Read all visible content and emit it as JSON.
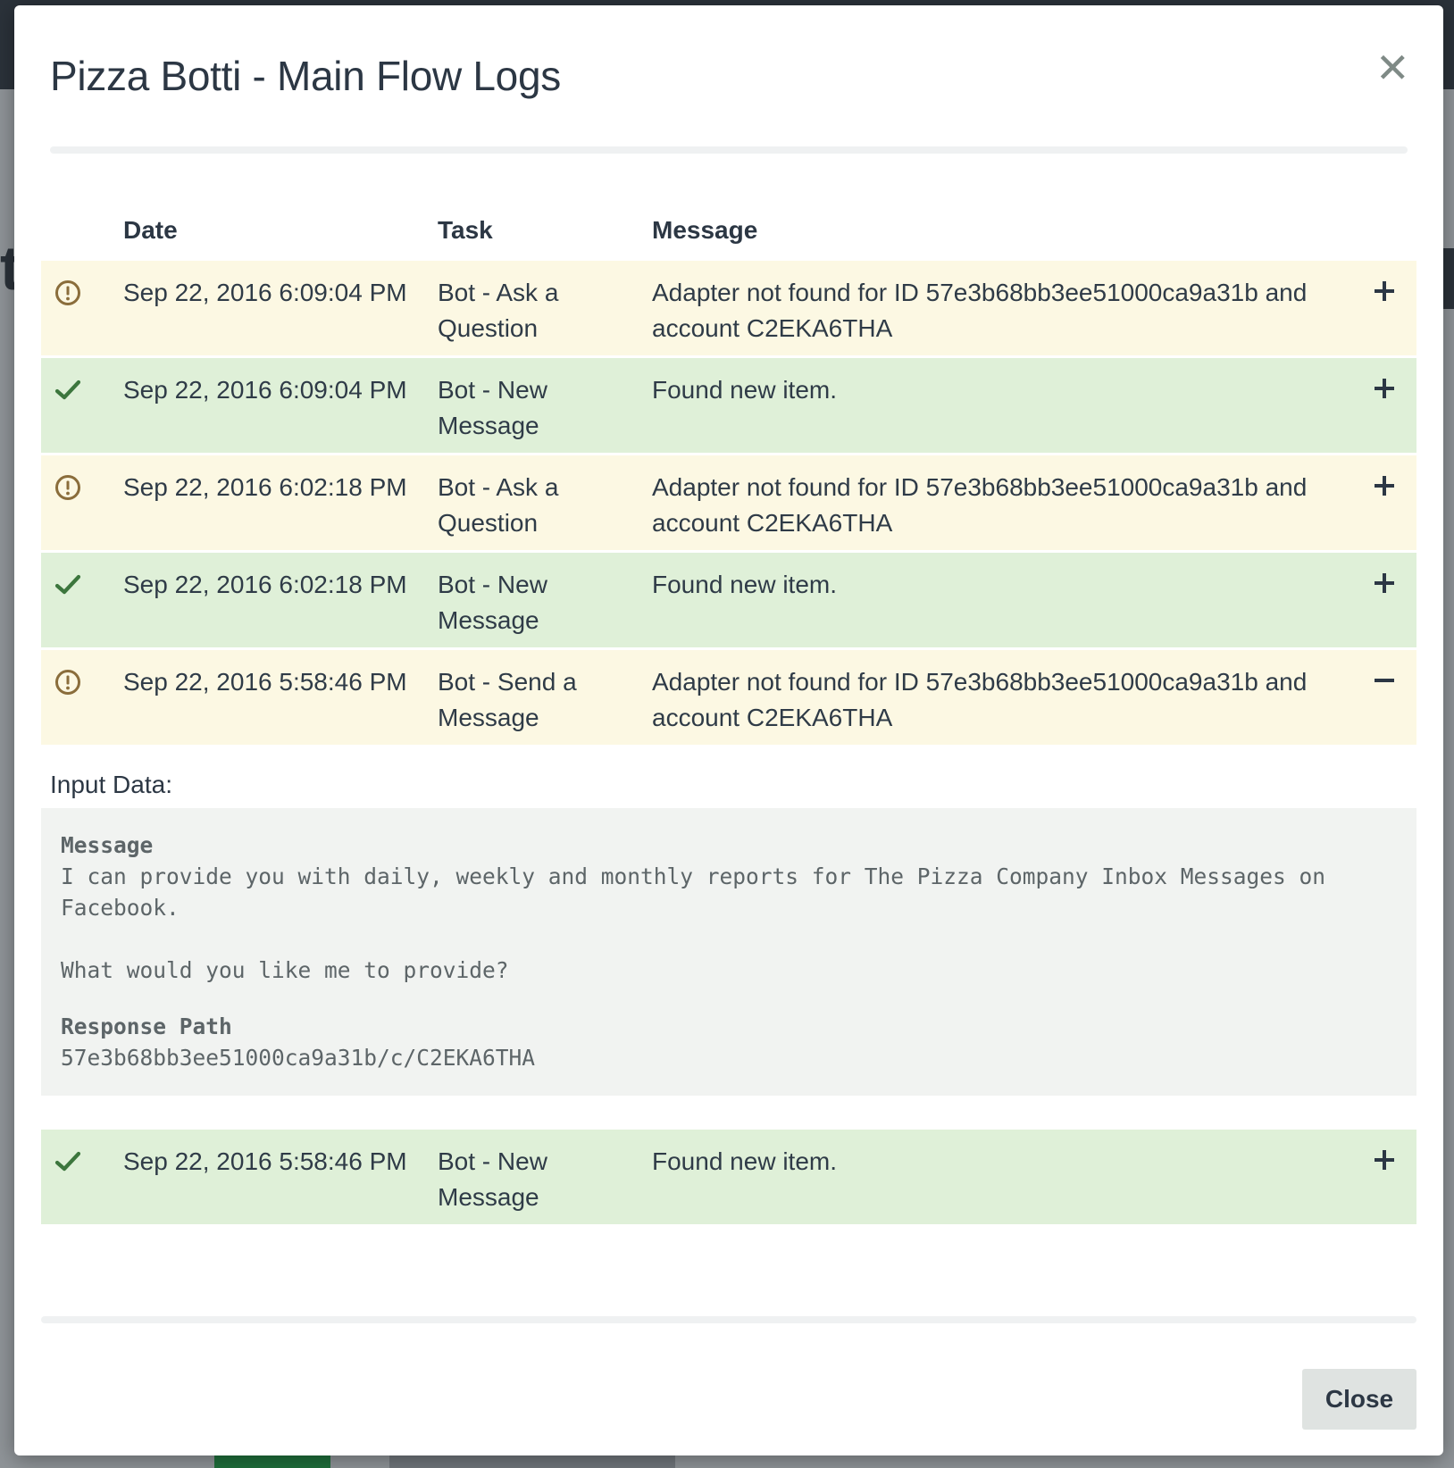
{
  "modal": {
    "title": "Pizza Botti - Main Flow Logs",
    "close_button_label": "Close"
  },
  "table": {
    "headers": {
      "date": "Date",
      "task": "Task",
      "message": "Message"
    },
    "rows": [
      {
        "status": "warning",
        "status_icon": "exclamation-circle-icon",
        "date": "Sep 22, 2016 6:09:04 PM",
        "task": "Bot - Ask a Question",
        "message": "Adapter not found for ID 57e3b68bb3ee51000ca9a31b and account C2EKA6THA",
        "expanded": false
      },
      {
        "status": "success",
        "status_icon": "check-icon",
        "date": "Sep 22, 2016 6:09:04 PM",
        "task": "Bot - New Message",
        "message": "Found new item.",
        "expanded": false
      },
      {
        "status": "warning",
        "status_icon": "exclamation-circle-icon",
        "date": "Sep 22, 2016 6:02:18 PM",
        "task": "Bot - Ask a Question",
        "message": "Adapter not found for ID 57e3b68bb3ee51000ca9a31b and account C2EKA6THA",
        "expanded": false
      },
      {
        "status": "success",
        "status_icon": "check-icon",
        "date": "Sep 22, 2016 6:02:18 PM",
        "task": "Bot - New Message",
        "message": "Found new item.",
        "expanded": false
      },
      {
        "status": "warning",
        "status_icon": "exclamation-circle-icon",
        "date": "Sep 22, 2016 5:58:46 PM",
        "task": "Bot - Send a Message",
        "message": "Adapter not found for ID 57e3b68bb3ee51000ca9a31b and account C2EKA6THA",
        "expanded": true
      },
      {
        "status": "success",
        "status_icon": "check-icon",
        "date": "Sep 22, 2016 5:58:46 PM",
        "task": "Bot - New Message",
        "message": "Found new item.",
        "expanded": false
      }
    ]
  },
  "details": {
    "label": "Input Data:",
    "fields": [
      {
        "key": "Message",
        "value": "I can provide you with daily, weekly and monthly reports for The Pizza Company Inbox Messages on Facebook.\n\nWhat would you like me to provide?"
      },
      {
        "key": "Response Path",
        "value": "57e3b68bb3ee51000ca9a31b/c/C2EKA6THA"
      }
    ]
  },
  "colors": {
    "warning_row_bg": "#fcf8e3",
    "success_row_bg": "#dff0d8",
    "warning_icon": "#8a6d3b",
    "success_icon": "#3c763d",
    "text": "#2f3b47"
  }
}
